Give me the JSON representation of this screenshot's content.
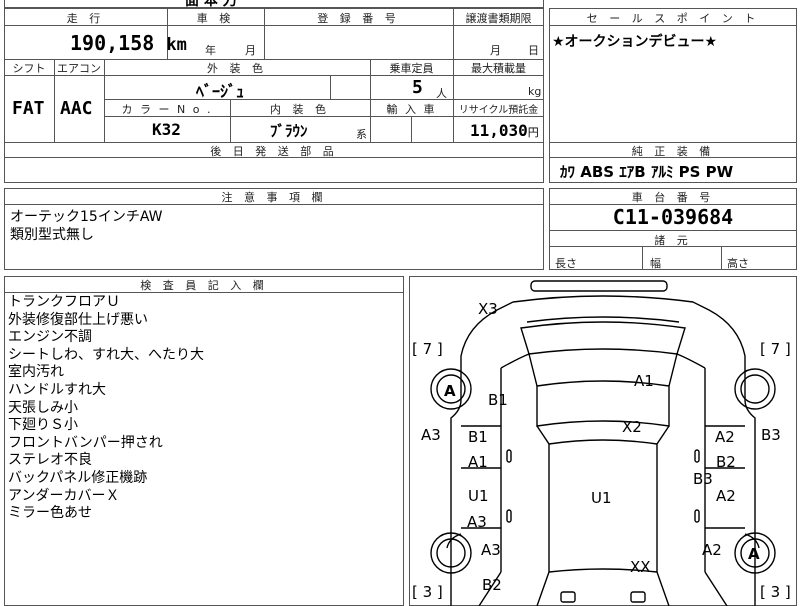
{
  "sheet": {
    "top_fragment": "面 本 刀",
    "headers": {
      "mileage": "走 行",
      "inspection": "車 検",
      "registration": "登 録 番 号",
      "transfer_deadline": "譲渡書類期限",
      "sales_point": "セ ー ル ス ポ イ ン ト",
      "shift": "シフト",
      "aircon": "エアコン",
      "exterior_color": "外 装 色",
      "capacity": "乗車定員",
      "max_load": "最大積載量",
      "color_no": "カ ラ ー N o .",
      "interior_color": "内 装 色",
      "import": "輸 入 車",
      "recycle_fee": "リサイクル預託金",
      "later_parts": "後 日 発 送 部 品",
      "genuine_equipment": "純 正 装 備",
      "caution": "注 意 事 項 欄",
      "chassis_no": "車 台 番 号",
      "specs": "諸 元",
      "inspector": "検 査 員 記 入 欄"
    },
    "mileage": {
      "value": "190,158",
      "unit": "km"
    },
    "inspection_date": {
      "year": "年",
      "month": "月"
    },
    "transfer_date": {
      "month": "月",
      "day": "日"
    },
    "sales_point_text": "★オークションデビュー★",
    "shift": "FAT",
    "aircon": "AAC",
    "exterior_color": "ﾍﾞｰｼﾞｭ",
    "capacity": {
      "value": "5",
      "unit": "人"
    },
    "max_load_unit": "kg",
    "color_no": "K32",
    "interior_color": "ﾌﾞﾗｳﾝ",
    "interior_suffix": "系",
    "recycle": {
      "value": "11,030",
      "unit": "円"
    },
    "equipment": "ｶﾜ ABS ｴｱB ｱﾙﾐ PS PW",
    "caution_notes": [
      "オーテック15インチAW",
      "類別型式無し"
    ],
    "chassis_no": "C11-039684",
    "specs": {
      "length": "長さ",
      "width": "幅",
      "height": "高さ"
    },
    "inspector_notes": [
      "トランクフロアＵ",
      "外装修復部仕上げ悪い",
      "エンジン不調",
      "シートしわ、すれ大、へたり大",
      "室内汚れ",
      "ハンドルすれ大",
      "天張しみ小",
      "下廻りＳ小",
      "フロントバンパー押され",
      "ステレオ不良",
      "バックパネル修正機跡",
      "アンダーカバーＸ",
      "ミラー色あせ"
    ]
  },
  "diagram": {
    "tires": {
      "fl": "[ 7 ]",
      "fr": "[ 7 ]",
      "rl": "[ 3 ]",
      "rr": "[ 3 ]"
    },
    "wheels": {
      "fl": "A",
      "rr": "A"
    },
    "marks": {
      "rear": "X3",
      "roof_top": "A1",
      "roof_left": "B1",
      "roof_mid": "X2",
      "left_side_a3": "A3",
      "rl_door_b1": "B1",
      "rl_door_a1": "A1",
      "fl_door_u1": "U1",
      "fl_door_a3": "A3",
      "center": "U1",
      "rr_door_a2": "A2",
      "rr_door_b2": "B2",
      "right_side_b3": "B3",
      "right_mid_b3": "B3",
      "fr_door_a2": "A2",
      "front_left_a3": "A3",
      "front_left_b2": "B2",
      "front_right_a2": "A2",
      "hood": "XX"
    }
  }
}
